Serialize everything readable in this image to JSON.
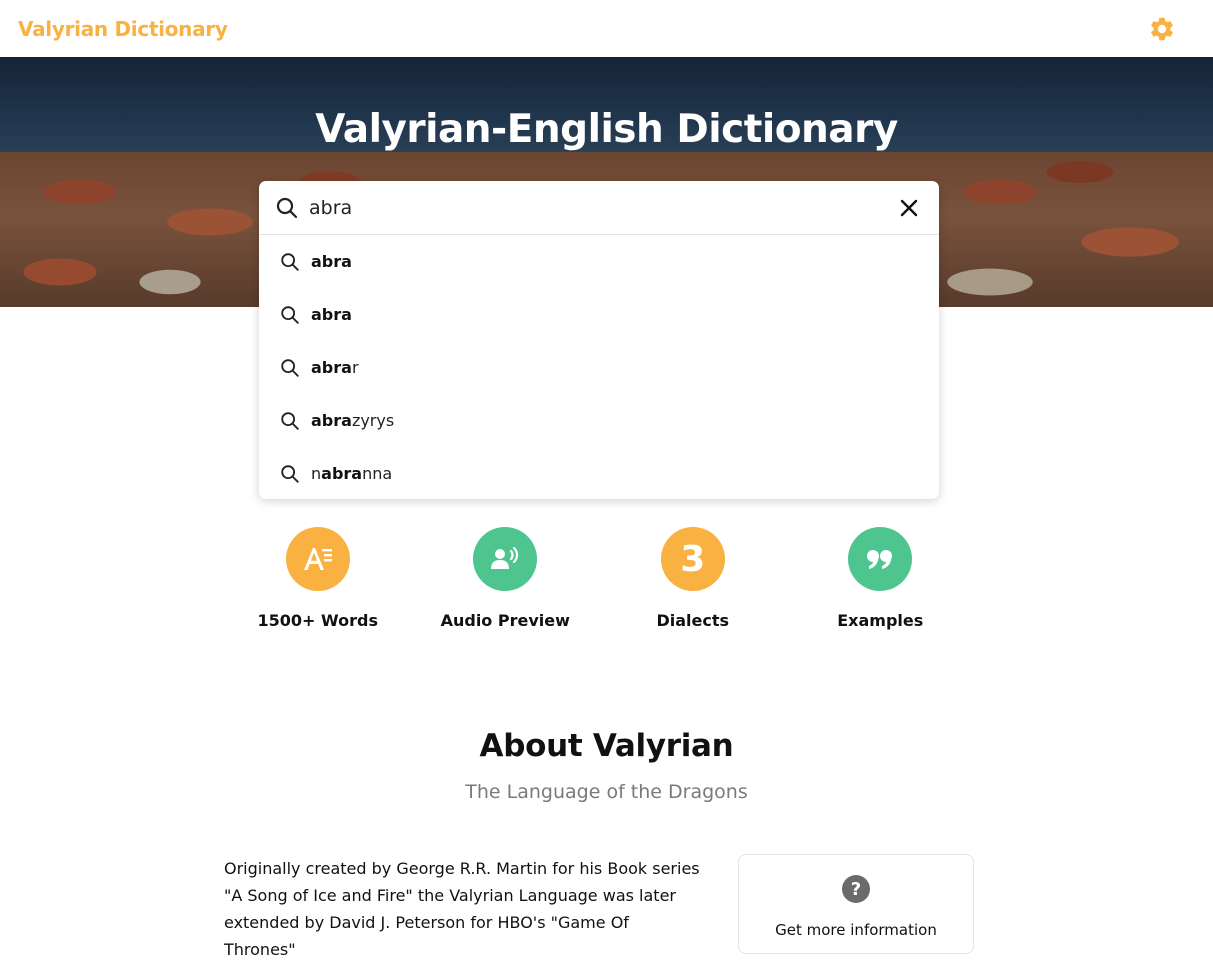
{
  "header": {
    "brand": "Valyrian Dictionary"
  },
  "hero": {
    "title": "Valyrian-English Dictionary"
  },
  "search": {
    "value": "abra",
    "suggestions": [
      {
        "match": "",
        "bold": "abra",
        "rest": ""
      },
      {
        "match": "",
        "bold": "abra",
        "rest": ""
      },
      {
        "match": "",
        "bold": "abra",
        "rest": "r"
      },
      {
        "match": "",
        "bold": "abra",
        "rest": "zyrys"
      },
      {
        "match": "n",
        "bold": "abra",
        "rest": "nna"
      }
    ]
  },
  "features": [
    {
      "label": "1500+ Words",
      "color": "#f9b141",
      "icon": "font-text-icon"
    },
    {
      "label": "Audio Preview",
      "color": "#4ec48f",
      "icon": "speaking-person-icon"
    },
    {
      "label": "Dialects",
      "color": "#f9b141",
      "icon": "number-badge",
      "number": "3"
    },
    {
      "label": "Examples",
      "color": "#4ec48f",
      "icon": "quote-icon"
    }
  ],
  "about": {
    "title": "About Valyrian",
    "subtitle": "The Language of the Dragons",
    "text_lines": [
      "Originally created by George R.R. Martin for his Book series",
      "\"A Song of Ice and Fire\" the Valyrian Language was later",
      "extended by David J. Peterson for HBO's \"Game Of Thrones\""
    ],
    "info_card_text": "Get more information"
  },
  "colors": {
    "accent": "#f9b141",
    "green": "#4ec48f"
  }
}
